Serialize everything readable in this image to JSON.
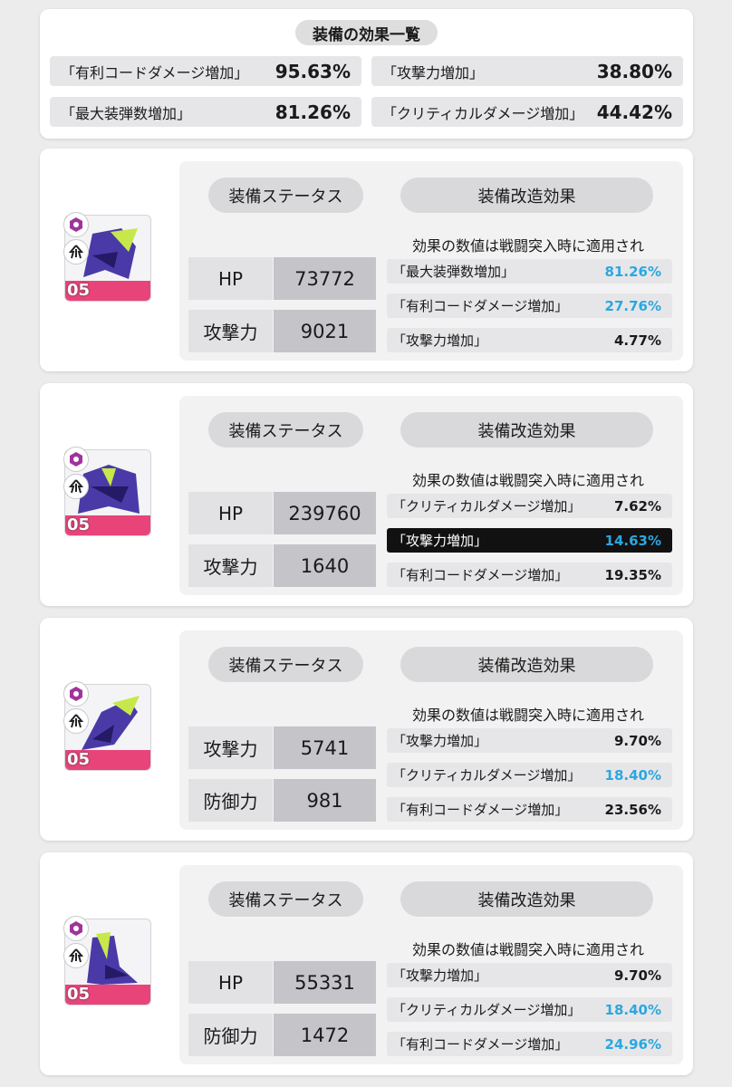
{
  "summary": {
    "title": "装備の効果一覧",
    "items": [
      {
        "name": "「有利コードダメージ増加」",
        "value": "95.63%"
      },
      {
        "name": "「攻撃力増加」",
        "value": "38.80%"
      },
      {
        "name": "「最大装弾数増加」",
        "value": "81.26%"
      },
      {
        "name": "「クリティカルダメージ増加」",
        "value": "44.42%"
      }
    ]
  },
  "common": {
    "status_label": "装備ステータス",
    "mod_label": "装備改造効果",
    "note": "効果の数値は戦闘突入時に適用され"
  },
  "colors": {
    "highlight_value": "#2ba7e0",
    "icon_base": "#e8447a",
    "armor": "#4a3aa8",
    "accent": "#c6e84a"
  },
  "equipment": [
    {
      "icon": "helmet-icon",
      "level": "05",
      "stats": [
        {
          "label": "HP",
          "value": "73772"
        },
        {
          "label": "攻撃力",
          "value": "9021"
        }
      ],
      "effects": [
        {
          "name": "「最大装弾数増加」",
          "value": "81.26%",
          "highlight": true,
          "selected": false
        },
        {
          "name": "「有利コードダメージ増加」",
          "value": "27.76%",
          "highlight": true,
          "selected": false
        },
        {
          "name": "「攻撃力増加」",
          "value": "4.77%",
          "highlight": false,
          "selected": false
        }
      ]
    },
    {
      "icon": "chest-armor-icon",
      "level": "05",
      "stats": [
        {
          "label": "HP",
          "value": "239760"
        },
        {
          "label": "攻撃力",
          "value": "1640"
        }
      ],
      "effects": [
        {
          "name": "「クリティカルダメージ増加」",
          "value": "7.62%",
          "highlight": false,
          "selected": false
        },
        {
          "name": "「攻撃力増加」",
          "value": "14.63%",
          "highlight": true,
          "selected": true
        },
        {
          "name": "「有利コードダメージ増加」",
          "value": "19.35%",
          "highlight": false,
          "selected": false
        }
      ]
    },
    {
      "icon": "gauntlet-icon",
      "level": "05",
      "stats": [
        {
          "label": "攻撃力",
          "value": "5741"
        },
        {
          "label": "防御力",
          "value": "981"
        }
      ],
      "effects": [
        {
          "name": "「攻撃力増加」",
          "value": "9.70%",
          "highlight": false,
          "selected": false
        },
        {
          "name": "「クリティカルダメージ増加」",
          "value": "18.40%",
          "highlight": true,
          "selected": false
        },
        {
          "name": "「有利コードダメージ増加」",
          "value": "23.56%",
          "highlight": false,
          "selected": false
        }
      ]
    },
    {
      "icon": "boots-icon",
      "level": "05",
      "stats": [
        {
          "label": "HP",
          "value": "55331"
        },
        {
          "label": "防御力",
          "value": "1472"
        }
      ],
      "effects": [
        {
          "name": "「攻撃力増加」",
          "value": "9.70%",
          "highlight": false,
          "selected": false
        },
        {
          "name": "「クリティカルダメージ増加」",
          "value": "18.40%",
          "highlight": true,
          "selected": false
        },
        {
          "name": "「有利コードダメージ増加」",
          "value": "24.96%",
          "highlight": true,
          "selected": false
        }
      ]
    }
  ]
}
